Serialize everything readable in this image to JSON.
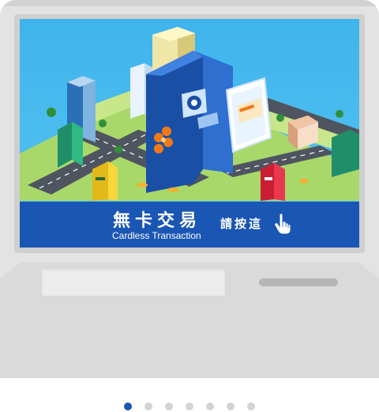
{
  "banner": {
    "title": "無卡交易",
    "subtitle": "Cardless Transaction",
    "cta": "請按這"
  },
  "pager": {
    "total": 7,
    "active_index": 0
  },
  "colors": {
    "banner_blue": "#1a56b3",
    "sky": "#48bbef",
    "atm_body": "#e3e3e3",
    "dot_active": "#1a56b3",
    "dot_inactive": "#d3d3d3"
  },
  "icons": [
    "hand-pointer-icon",
    "bank-logo-icon",
    "flower-logo-icon",
    "credit-card-icon"
  ]
}
